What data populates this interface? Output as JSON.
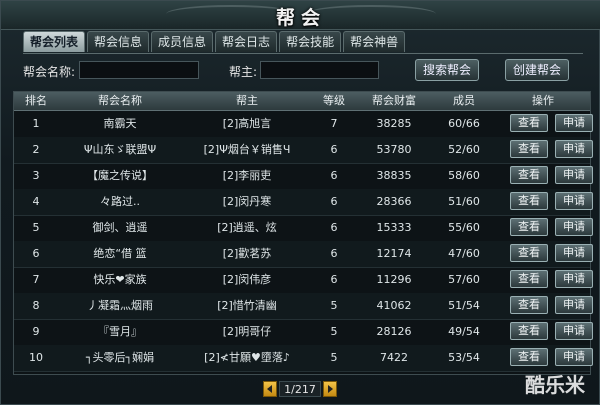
{
  "title": "帮会",
  "tabs": [
    "帮会列表",
    "帮会信息",
    "成员信息",
    "帮会日志",
    "帮会技能",
    "帮会神兽"
  ],
  "search": {
    "name_label": "帮会名称:",
    "leader_label": "帮主:",
    "name_value": "",
    "leader_value": "",
    "search_button": "搜索帮会",
    "create_button": "创建帮会"
  },
  "table": {
    "headers": [
      "排名",
      "帮会名称",
      "帮主",
      "等级",
      "帮会财富",
      "成员",
      "操作"
    ],
    "view_label": "查看",
    "apply_label": "申请",
    "rows": [
      {
        "rank": "1",
        "name": "南霸天",
        "leader": "[2]高旭言",
        "level": "7",
        "wealth": "38285",
        "members": "60/66"
      },
      {
        "rank": "2",
        "name": "Ψ山东ゞ联盟Ψ",
        "leader": "[2]Ψ烟台￥销售Ч",
        "level": "6",
        "wealth": "53780",
        "members": "52/60"
      },
      {
        "rank": "3",
        "name": "【魔之传说】",
        "leader": "[2]李丽吏",
        "level": "6",
        "wealth": "38835",
        "members": "58/60"
      },
      {
        "rank": "4",
        "name": "々路过..",
        "leader": "[2]闵丹寒",
        "level": "6",
        "wealth": "28366",
        "members": "51/60"
      },
      {
        "rank": "5",
        "name": "御剑、逍遥",
        "leader": "[2]逍遥、炫",
        "level": "6",
        "wealth": "15333",
        "members": "55/60"
      },
      {
        "rank": "6",
        "name": "绝恋“借 篮",
        "leader": "[2]歡茗苏",
        "level": "6",
        "wealth": "12174",
        "members": "47/60"
      },
      {
        "rank": "7",
        "name": "快乐❤家族",
        "leader": "[2]闵伟彦",
        "level": "6",
        "wealth": "11296",
        "members": "57/60"
      },
      {
        "rank": "8",
        "name": "丿凝霜灬烟雨",
        "leader": "[2]惜竹清幽",
        "level": "5",
        "wealth": "41062",
        "members": "51/54"
      },
      {
        "rank": "9",
        "name": "『雪月』",
        "leader": "[2]明哥仔",
        "level": "5",
        "wealth": "28126",
        "members": "49/54"
      },
      {
        "rank": "10",
        "name": "┐头零后┐娴娟",
        "leader": "[2]≮甘願♥墮落♪",
        "level": "5",
        "wealth": "7422",
        "members": "53/54"
      }
    ]
  },
  "pager": {
    "text": "1/217"
  },
  "watermark": "酷乐米"
}
